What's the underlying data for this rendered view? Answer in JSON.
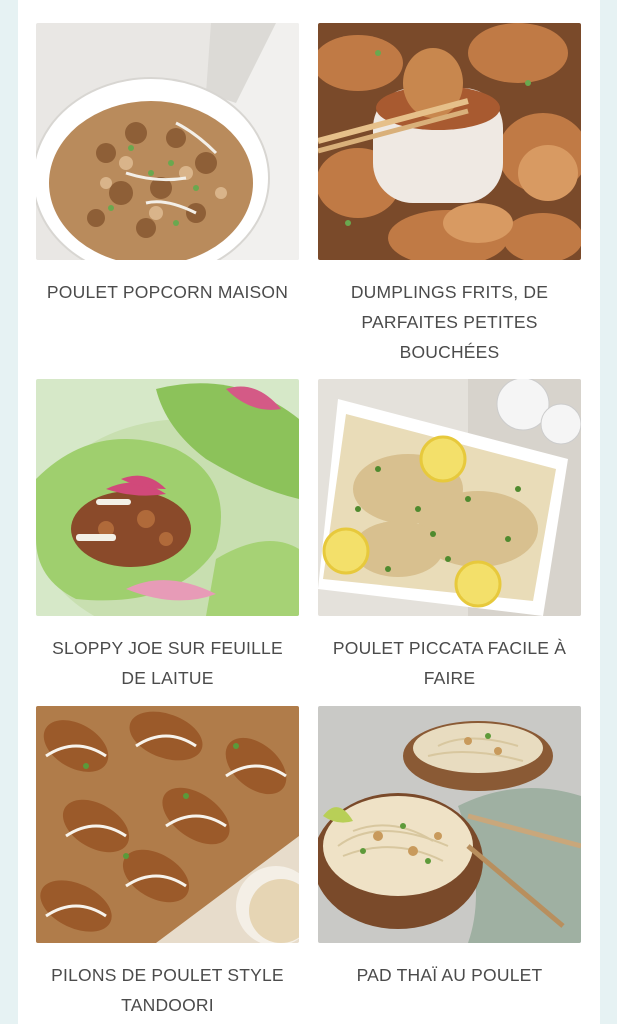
{
  "recipes": [
    {
      "title": "POULET POPCORN MAISON",
      "image_alt": "Poulet popcorn maison"
    },
    {
      "title": "DUMPLINGS FRITS, DE PARFAITES PETITES BOUCHÉES",
      "image_alt": "Dumplings frits"
    },
    {
      "title": "SLOPPY JOE SUR FEUILLE DE LAITUE",
      "image_alt": "Sloppy joe sur feuille de laitue"
    },
    {
      "title": "POULET PICCATA FACILE À FAIRE",
      "image_alt": "Poulet piccata"
    },
    {
      "title": "PILONS DE POULET STYLE TANDOORI",
      "image_alt": "Pilons de poulet tandoori"
    },
    {
      "title": "PAD THAÏ AU POULET",
      "image_alt": "Pad thaï au poulet"
    }
  ],
  "colors": {
    "background_outer": "#e6f2f3",
    "card_text": "#4b4b4b"
  }
}
